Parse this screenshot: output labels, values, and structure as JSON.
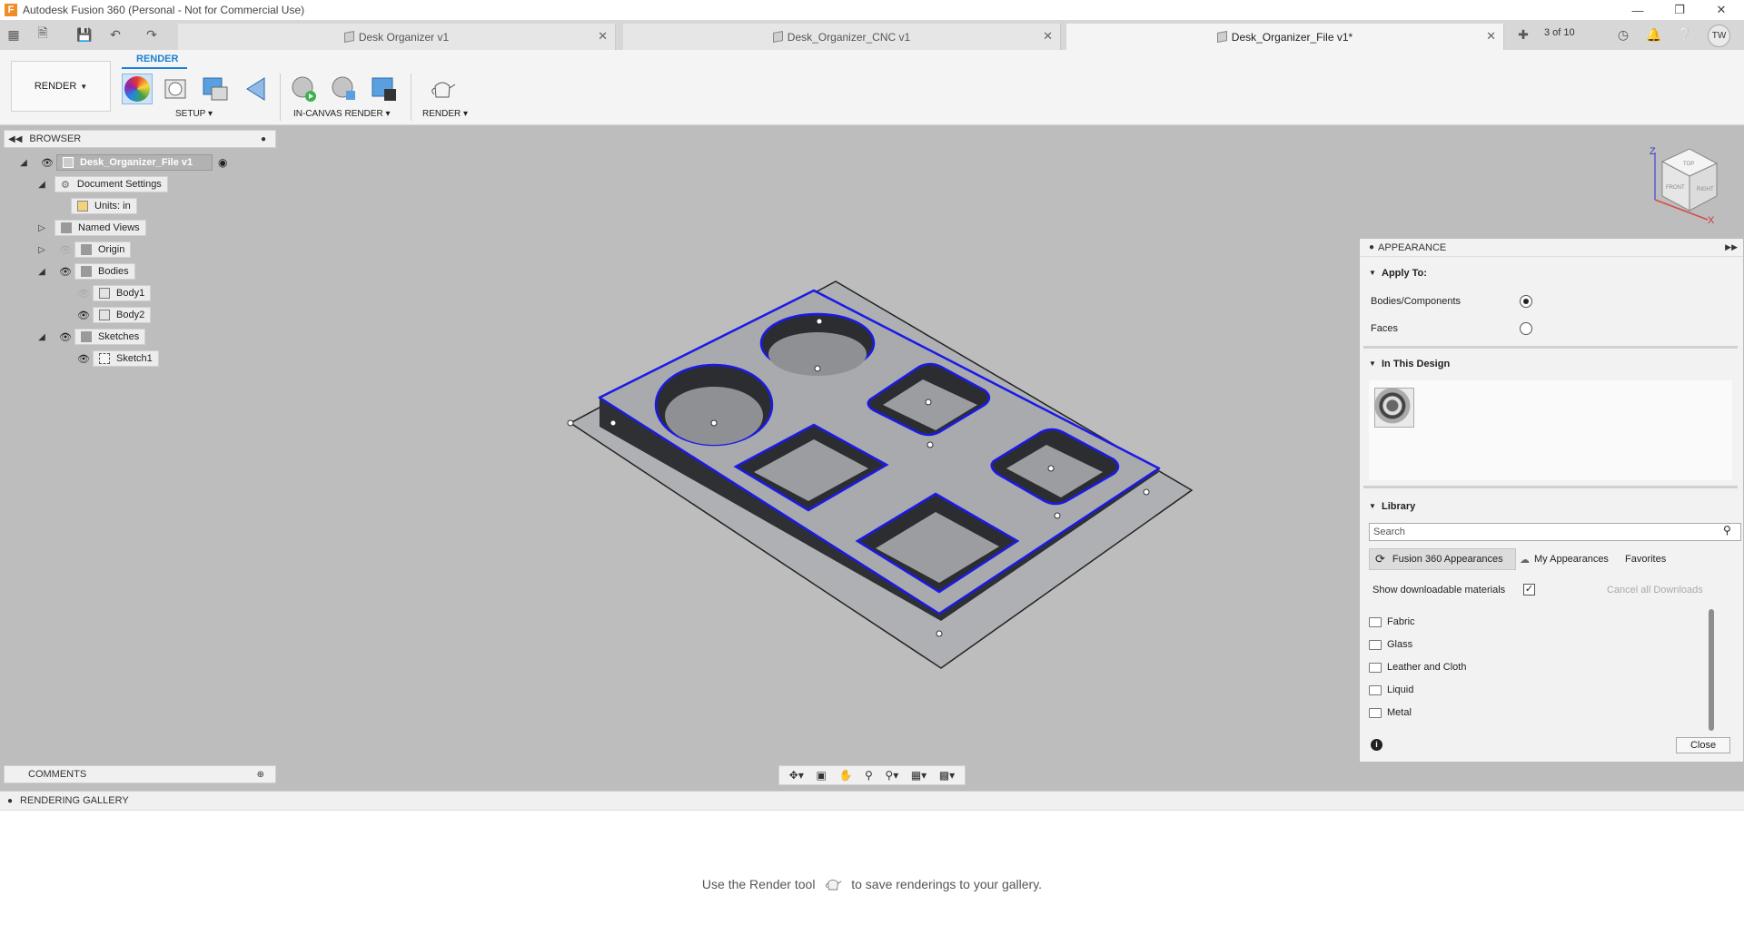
{
  "window": {
    "title": "Autodesk Fusion 360 (Personal - Not for Commercial Use)",
    "minimize_icon": "minimize-icon",
    "maximize_icon": "restore-icon",
    "close_icon": "close-icon"
  },
  "tabs": [
    {
      "label": "Desk Organizer v1",
      "active": false
    },
    {
      "label": "Desk_Organizer_CNC v1",
      "active": false
    },
    {
      "label": "Desk_Organizer_File v1*",
      "active": true
    }
  ],
  "tab_counter": "3 of 10",
  "user_initials": "TW",
  "toolbar": {
    "workspace": "RENDER",
    "tab": "RENDER",
    "groups": {
      "setup": "SETUP",
      "in_canvas": "IN-CANVAS RENDER",
      "render": "RENDER"
    }
  },
  "browser": {
    "title": "BROWSER",
    "root": "Desk_Organizer_File v1",
    "items": [
      {
        "label": "Document Settings"
      },
      {
        "label": "Units: in"
      },
      {
        "label": "Named Views"
      },
      {
        "label": "Origin"
      },
      {
        "label": "Bodies"
      },
      {
        "label": "Body1"
      },
      {
        "label": "Body2"
      },
      {
        "label": "Sketches"
      },
      {
        "label": "Sketch1"
      }
    ]
  },
  "viewcube": {
    "axes": {
      "z": "Z",
      "x": "X"
    },
    "faces": {
      "top": "TOP",
      "front": "FRONT",
      "right": "RIGHT"
    }
  },
  "appearance": {
    "title": "APPEARANCE",
    "apply_to": {
      "title": "Apply To:",
      "options": [
        {
          "label": "Bodies/Components",
          "selected": true
        },
        {
          "label": "Faces",
          "selected": false
        }
      ]
    },
    "in_this_design": {
      "title": "In This Design"
    },
    "library": {
      "title": "Library",
      "search_placeholder": "Search",
      "tabs": [
        "Fusion 360 Appearances",
        "My Appearances",
        "Favorites"
      ],
      "show_downloadable": "Show downloadable materials",
      "show_downloadable_checked": true,
      "cancel_downloads": "Cancel all Downloads",
      "folders": [
        "Fabric",
        "Glass",
        "Leather and Cloth",
        "Liquid",
        "Metal"
      ]
    },
    "close": "Close"
  },
  "comments": {
    "title": "COMMENTS"
  },
  "gallery": {
    "title": "RENDERING GALLERY",
    "message_before": "Use the Render tool",
    "message_after": "to save renderings to your gallery."
  },
  "colors": {
    "accent": "#1c7fd6",
    "canvas_bg": "#bdbdbd",
    "sketch_line": "#1a1ae6"
  }
}
